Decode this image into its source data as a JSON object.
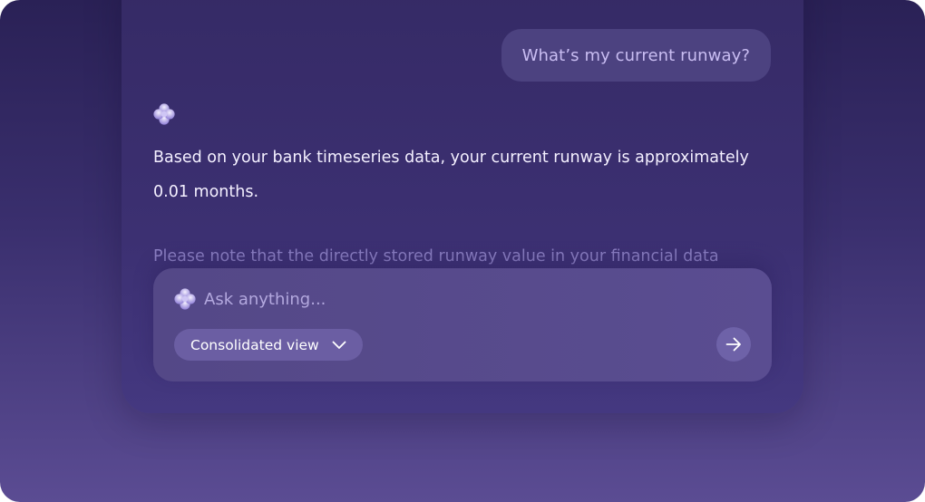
{
  "conversation": {
    "user_message": "What’s my current runway?",
    "assistant_icon": "sparkle-flower-icon",
    "assistant_answer": "Based on your bank timeseries data, your current runway is approximately 0.01 months.",
    "assistant_note_partial": "Please note that the directly stored runway value in your financial data"
  },
  "composer": {
    "icon": "sparkle-flower-icon",
    "placeholder": "Ask anything...",
    "value": "",
    "view_selector": {
      "selected": "Consolidated view",
      "icon": "chevron-down-icon"
    },
    "send_icon": "arrow-right-icon"
  },
  "colors": {
    "background_top": "#2a2156",
    "background_bottom": "#5b4c93",
    "panel": "#3c3072",
    "user_bubble": "#4c4280",
    "composer": "#574a8c",
    "chip": "#6b5ea3",
    "text_primary": "#f4f0ff",
    "text_muted": "#8b7fc2"
  }
}
